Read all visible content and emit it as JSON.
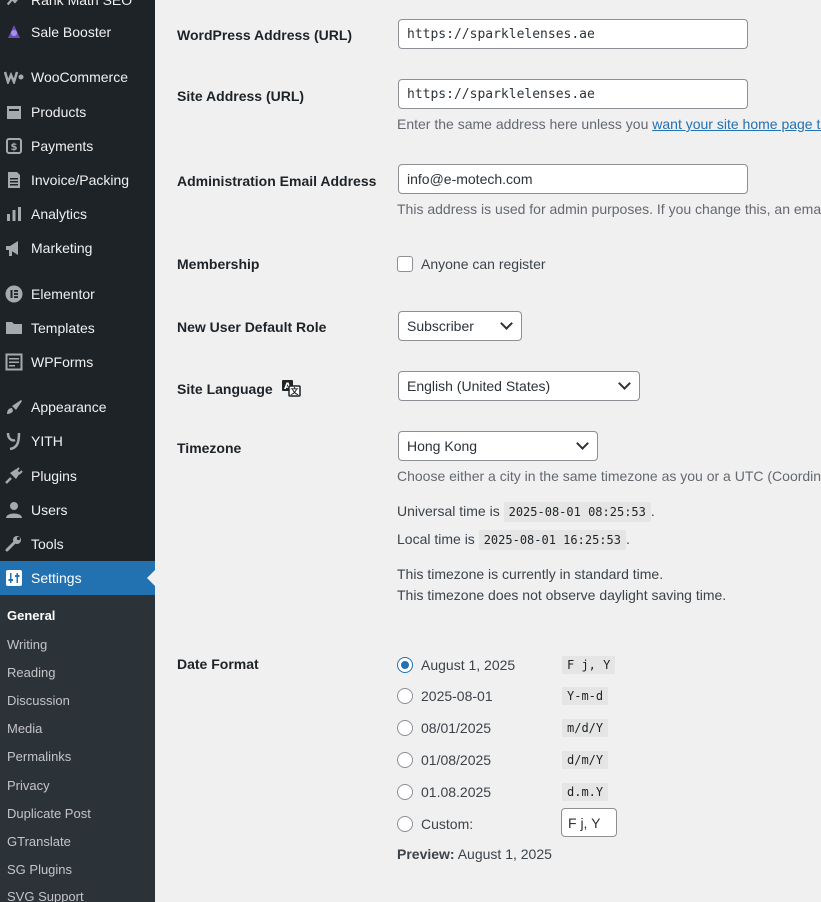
{
  "sidebar": {
    "items": [
      {
        "label": "Rank Math SEO",
        "icon": "rank-math-icon"
      },
      {
        "label": "Sale Booster",
        "icon": "sale-booster-icon"
      },
      {
        "label": "WooCommerce",
        "icon": "woocommerce-icon"
      },
      {
        "label": "Products",
        "icon": "products-icon"
      },
      {
        "label": "Payments",
        "icon": "payments-icon"
      },
      {
        "label": "Invoice/Packing",
        "icon": "invoice-icon"
      },
      {
        "label": "Analytics",
        "icon": "analytics-icon"
      },
      {
        "label": "Marketing",
        "icon": "marketing-icon"
      },
      {
        "label": "Elementor",
        "icon": "elementor-icon"
      },
      {
        "label": "Templates",
        "icon": "folder-icon"
      },
      {
        "label": "WPForms",
        "icon": "wpforms-icon"
      },
      {
        "label": "Appearance",
        "icon": "paintbrush-icon"
      },
      {
        "label": "YITH",
        "icon": "yith-icon"
      },
      {
        "label": "Plugins",
        "icon": "plugin-icon"
      },
      {
        "label": "Users",
        "icon": "users-icon"
      },
      {
        "label": "Tools",
        "icon": "wrench-icon"
      },
      {
        "label": "Settings",
        "icon": "settings-icon"
      }
    ],
    "submenu": [
      "General",
      "Writing",
      "Reading",
      "Discussion",
      "Media",
      "Permalinks",
      "Privacy",
      "Duplicate Post",
      "GTranslate",
      "SG Plugins",
      "SVG Support"
    ]
  },
  "form": {
    "wp_address": {
      "label": "WordPress Address (URL)",
      "value": "https://sparklelenses.ae"
    },
    "site_address": {
      "label": "Site Address (URL)",
      "value": "https://sparklelenses.ae",
      "desc_prefix": "Enter the same address here unless you ",
      "desc_link": "want your site home page to"
    },
    "admin_email": {
      "label": "Administration Email Address",
      "value": "info@e-motech.com",
      "desc": "This address is used for admin purposes. If you change this, an email"
    },
    "membership": {
      "label": "Membership",
      "checkbox_label": "Anyone can register",
      "checked": false
    },
    "default_role": {
      "label": "New User Default Role",
      "value": "Subscriber"
    },
    "site_language": {
      "label": "Site Language",
      "value": "English (United States)"
    },
    "timezone": {
      "label": "Timezone",
      "value": "Hong Kong",
      "desc": "Choose either a city in the same timezone as you or a UTC (Coordinat",
      "universal_prefix": "Universal time is",
      "universal_time": "2025-08-01 08:25:53",
      "local_prefix": "Local time is",
      "local_time": "2025-08-01 16:25:53",
      "standard_note": "This timezone is currently in standard time.",
      "dst_note": "This timezone does not observe daylight saving time."
    },
    "date_format": {
      "label": "Date Format",
      "options": [
        {
          "label": "August 1, 2025",
          "code": "F j, Y",
          "checked": true
        },
        {
          "label": "2025-08-01",
          "code": "Y-m-d",
          "checked": false
        },
        {
          "label": "08/01/2025",
          "code": "m/d/Y",
          "checked": false
        },
        {
          "label": "01/08/2025",
          "code": "d/m/Y",
          "checked": false
        },
        {
          "label": "01.08.2025",
          "code": "d.m.Y",
          "checked": false
        }
      ],
      "custom_label": "Custom:",
      "custom_value": "F j, Y",
      "preview_label": "Preview:",
      "preview_value": "August 1, 2025"
    }
  },
  "colors": {
    "sidebar_bg": "#1d2327",
    "active": "#2271b1",
    "link": "#2271b1"
  }
}
